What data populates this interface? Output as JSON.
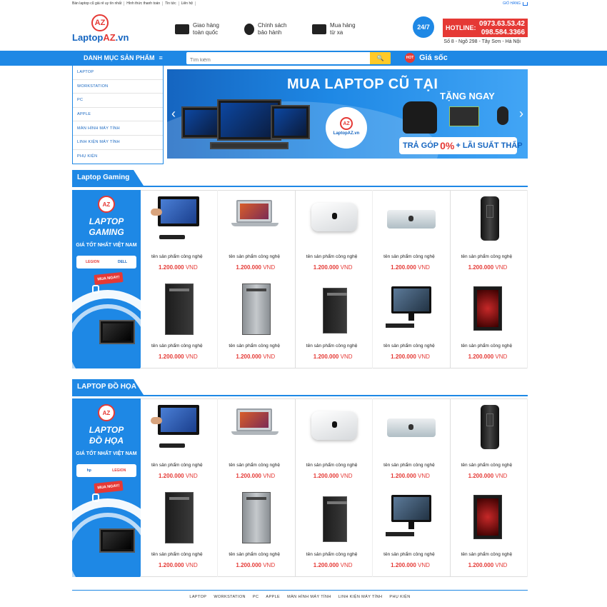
{
  "topbar": {
    "links": [
      "Bán laptop cũ giá rẻ uy tín nhất",
      "Hình thức thanh toán",
      "Tin tức",
      "Liên hệ"
    ],
    "cart_label": "GIỎ HÀNG"
  },
  "header": {
    "logo_mark": "AZ",
    "logo_text_1": "Laptop",
    "logo_text_2": "AZ",
    "logo_text_3": ".vn",
    "features": [
      {
        "icon": "truck-icon",
        "line1": "Giao hàng",
        "line2": "toàn quốc"
      },
      {
        "icon": "medal-icon",
        "line1": "Chính sách",
        "line2": "bảo hành"
      },
      {
        "icon": "card-icon",
        "line1": "Mua hàng",
        "line2": "từ xa"
      }
    ],
    "hotline_badge": "24/7",
    "hotline_label": "HOTLINE:",
    "phone1": "0973.63.53.42",
    "phone2": "098.584.3366",
    "address": "Số 8 - Ngõ 298 - Tây Sơn - Hà Nội"
  },
  "nav": {
    "category_label": "DANH MỤC SẢN PHẨM",
    "menu_glyph": "≡",
    "search_placeholder": "Tìm kiếm",
    "search_icon": "🔍",
    "hot_badge": "HOT",
    "hot_label": "Giá sốc"
  },
  "menu": [
    "LAPTOP",
    "WORKSTATION",
    "PC",
    "APPLE",
    "MÀN HÌNH MÁY TÍNH",
    "LINH KIỆN MÁY TÍNH",
    "PHỤ KIỆN"
  ],
  "banner": {
    "title": "MUA LAPTOP CŨ TẠI",
    "logo_mark": "AZ",
    "logo_name": "LaptopAZ.vn",
    "gift_label": "TẶNG NGAY",
    "promo_1": "TRẢ GÓP",
    "promo_2": "0%",
    "promo_3": "+ LÃI SUẤT THẤP"
  },
  "sections": [
    {
      "title": "Laptop Gaming",
      "promo_title_1": "LAPTOP",
      "promo_title_2": "GAMING",
      "promo_sub": "GIÁ TỐT NHẤT VIỆT NAM",
      "brand_1": "LEGION",
      "brand_2": "DELL",
      "buy_label": "MUA NGAY!",
      "products": [
        {
          "name": "tên sản phẩm công nghệ",
          "price": "1.200.000",
          "currency": "VND",
          "shape": "aio"
        },
        {
          "name": "tên sản phẩm công nghệ",
          "price": "1.200.000",
          "currency": "VND",
          "shape": "mac"
        },
        {
          "name": "tên sản phẩm công nghệ",
          "price": "1.200.000",
          "currency": "VND",
          "shape": "mini"
        },
        {
          "name": "tên sản phẩm công nghệ",
          "price": "1.200.000",
          "currency": "VND",
          "shape": "mmini"
        },
        {
          "name": "tên sản phẩm công nghệ",
          "price": "1.200.000",
          "currency": "VND",
          "shape": "pro"
        },
        {
          "name": "tên sản phẩm công nghệ",
          "price": "1.200.000",
          "currency": "VND",
          "shape": "tower"
        },
        {
          "name": "tên sản phẩm công nghệ",
          "price": "1.200.000",
          "currency": "VND",
          "shape": "tower silver"
        },
        {
          "name": "tên sản phẩm công nghệ",
          "price": "1.200.000",
          "currency": "VND",
          "shape": "tower small"
        },
        {
          "name": "tên sản phẩm công nghệ",
          "price": "1.200.000",
          "currency": "VND",
          "shape": "desk"
        },
        {
          "name": "tên sản phẩm công nghệ",
          "price": "1.200.000",
          "currency": "VND",
          "shape": "red"
        }
      ]
    },
    {
      "title": "LAPTOP ĐỒ HỌA",
      "promo_title_1": "LAPTOP",
      "promo_title_2": "ĐỒ HỌA",
      "promo_sub": "GIÁ TỐT NHẤT VIỆT NAM",
      "brand_1": "hp",
      "brand_2": "LEGION",
      "buy_label": "MUA NGAY!",
      "products": [
        {
          "name": "tên sản phẩm công nghệ",
          "price": "1.200.000",
          "currency": "VND",
          "shape": "aio"
        },
        {
          "name": "tên sản phẩm công nghệ",
          "price": "1.200.000",
          "currency": "VND",
          "shape": "mac"
        },
        {
          "name": "tên sản phẩm công nghệ",
          "price": "1.200.000",
          "currency": "VND",
          "shape": "mini"
        },
        {
          "name": "tên sản phẩm công nghệ",
          "price": "1.200.000",
          "currency": "VND",
          "shape": "mmini"
        },
        {
          "name": "tên sản phẩm công nghệ",
          "price": "1.200.000",
          "currency": "VND",
          "shape": "pro"
        },
        {
          "name": "tên sản phẩm công nghệ",
          "price": "1.200.000",
          "currency": "VND",
          "shape": "tower"
        },
        {
          "name": "tên sản phẩm công nghệ",
          "price": "1.200.000",
          "currency": "VND",
          "shape": "tower silver"
        },
        {
          "name": "tên sản phẩm công nghệ",
          "price": "1.200.000",
          "currency": "VND",
          "shape": "tower small"
        },
        {
          "name": "tên sản phẩm công nghệ",
          "price": "1.200.000",
          "currency": "VND",
          "shape": "desk"
        },
        {
          "name": "tên sản phẩm công nghệ",
          "price": "1.200.000",
          "currency": "VND",
          "shape": "red"
        }
      ]
    }
  ],
  "footer": {
    "links": [
      "LAPTOP",
      "WORKSTATION",
      "PC",
      "APPLE",
      "MÀN HÌNH MÁY TÍNH",
      "LINH KIỆN MÁY TÍNH",
      "PHỤ KIỆN"
    ]
  },
  "colors": {
    "primary": "#1e88e5",
    "accent": "#e53935",
    "search_button": "#ffca28"
  }
}
